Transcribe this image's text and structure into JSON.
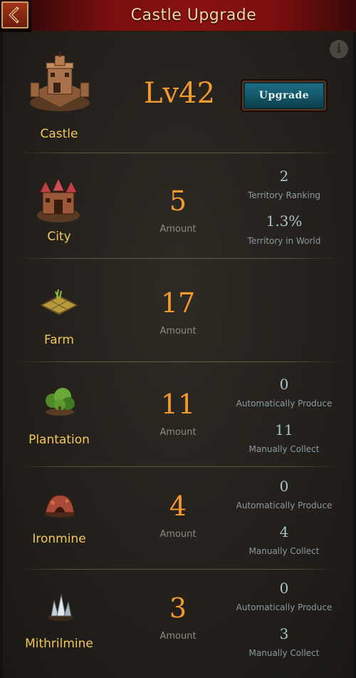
{
  "header": {
    "title": "Castle Upgrade",
    "back_icon": "chevron-left-icon"
  },
  "castle": {
    "name": "Castle",
    "level": "Lv42",
    "upgrade_label": "Upgrade",
    "icon": "castle-icon"
  },
  "info_icon": {
    "symbol": "i"
  },
  "rows": [
    {
      "name": "City",
      "amount": "5",
      "amount_label": "Amount",
      "stat1_value": "2",
      "stat1_label": "Territory Ranking",
      "stat2_value": "1.3%",
      "stat2_label": "Territory in World",
      "icon": "city-icon"
    },
    {
      "name": "Farm",
      "amount": "17",
      "amount_label": "Amount",
      "icon": "farm-icon"
    },
    {
      "name": "Plantation",
      "amount": "11",
      "amount_label": "Amount",
      "stat1_value": "0",
      "stat1_label": "Automatically Produce",
      "stat2_value": "11",
      "stat2_label": "Manually Collect",
      "icon": "plantation-icon"
    },
    {
      "name": "Ironmine",
      "amount": "4",
      "amount_label": "Amount",
      "stat1_value": "0",
      "stat1_label": "Automatically Produce",
      "stat2_value": "4",
      "stat2_label": "Manually Collect",
      "icon": "ironmine-icon"
    },
    {
      "name": "Mithrilmine",
      "amount": "3",
      "amount_label": "Amount",
      "stat1_value": "0",
      "stat1_label": "Automatically Produce",
      "stat2_value": "3",
      "stat2_label": "Manually Collect",
      "icon": "mithrilmine-icon"
    }
  ],
  "colors": {
    "accent_gold": "#f2c85a",
    "number_orange": "#f29a2c",
    "stat_teal": "#a8c3c9",
    "title_red": "#8a1111"
  }
}
